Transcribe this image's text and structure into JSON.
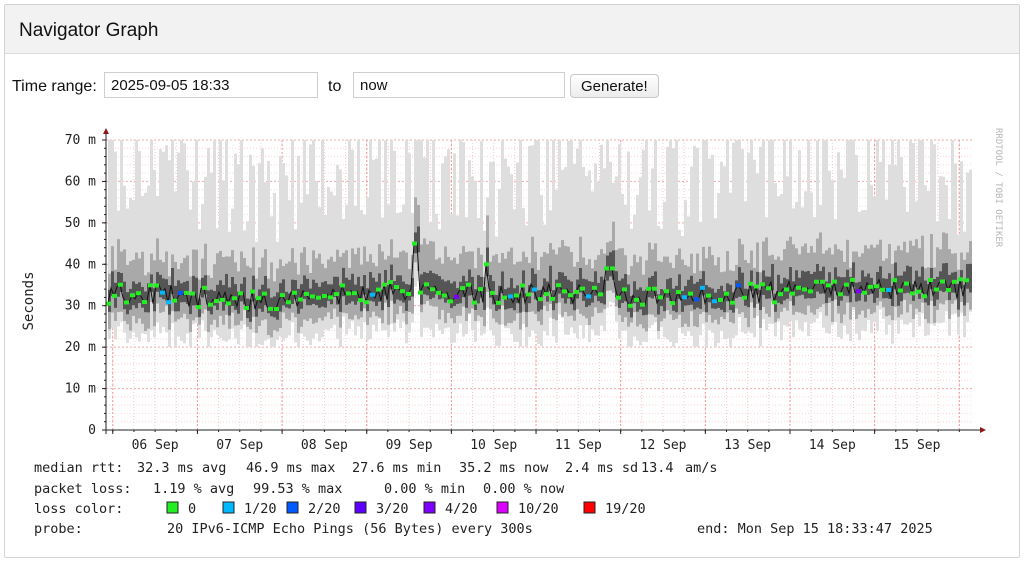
{
  "panel": {
    "title": "Navigator Graph"
  },
  "controls": {
    "time_range_label": "Time range:",
    "from_value": "2025-09-05 18:33",
    "to_label": "to",
    "to_value": "now",
    "generate_label": "Generate!"
  },
  "chart_data": {
    "type": "area",
    "ylabel": "Seconds",
    "ylim": [
      0,
      70
    ],
    "y_ticks": [
      "0",
      "10 m",
      "20 m",
      "30 m",
      "40 m",
      "50 m",
      "60 m",
      "70 m"
    ],
    "x_ticks": [
      "06 Sep",
      "07 Sep",
      "08 Sep",
      "09 Sep",
      "10 Sep",
      "11 Sep",
      "12 Sep",
      "13 Sep",
      "14 Sep",
      "15 Sep"
    ],
    "side_label": "RRDTOOL / TOBI OETIKER",
    "grid": true,
    "series": [
      {
        "name": "median rtt",
        "x": [
          "06 Sep",
          "07 Sep",
          "08 Sep",
          "09 Sep",
          "10 Sep",
          "11 Sep",
          "12 Sep",
          "13 Sep",
          "14 Sep",
          "15 Sep"
        ],
        "values": [
          33,
          31,
          32,
          34,
          33,
          33,
          32,
          33,
          34,
          34
        ]
      }
    ],
    "stats": {
      "median_rtt": {
        "label": "median rtt:",
        "avg": "32.3 ms avg",
        "max": "46.9 ms max",
        "min": "27.6 ms min",
        "now": "35.2 ms now",
        "sd": "2.4 ms sd",
        "ams": "13.4",
        "ams_unit": "am/s"
      },
      "packet_loss": {
        "label": "packet loss:",
        "avg": "1.19 % avg",
        "max": "99.53 % max",
        "min": "0.00 % min",
        "now": "0.00 % now"
      },
      "loss_color": {
        "label": "loss color:",
        "items": [
          {
            "label": "0",
            "color": "#22ee22"
          },
          {
            "label": "1/20",
            "color": "#00b8ff"
          },
          {
            "label": "2/20",
            "color": "#0059ff"
          },
          {
            "label": "3/20",
            "color": "#5e00ff"
          },
          {
            "label": "4/20",
            "color": "#7e00ff"
          },
          {
            "label": "10/20",
            "color": "#dd00ff"
          },
          {
            "label": "19/20",
            "color": "#ff0000"
          }
        ]
      },
      "probe": {
        "label": "probe:",
        "value": "20 IPv6-ICMP Echo Pings (56 Bytes) every 300s",
        "end": "end: Mon Sep 15 18:33:47 2025"
      }
    }
  }
}
